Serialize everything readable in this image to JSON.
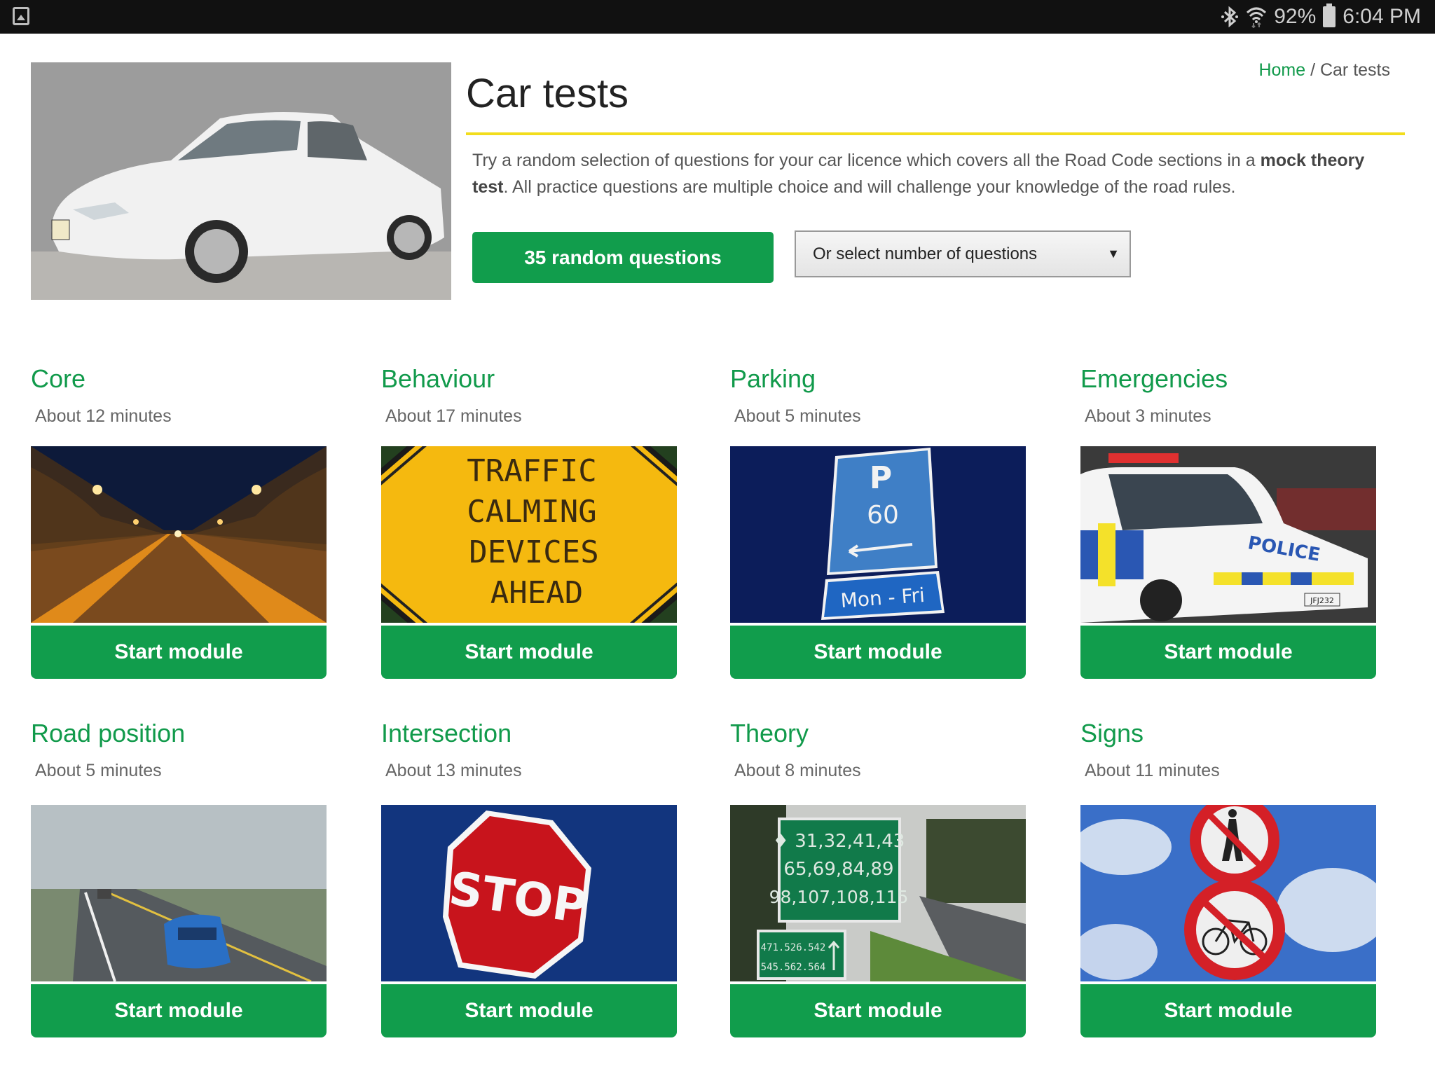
{
  "status_bar": {
    "left_icon": "gallery-icon",
    "bluetooth_icon": "bluetooth-icon",
    "wifi_icon": "wifi-icon",
    "battery_percent": "92%",
    "battery_icon": "battery-icon",
    "time": "6:04 PM"
  },
  "header": {
    "title": "Car tests",
    "breadcrumb": {
      "home": "Home",
      "separator": " / ",
      "current": "Car tests"
    },
    "hero_image": "white hatchback car",
    "intro_before": "Try a random selection of questions for your car licence which covers all the Road Code sections in a ",
    "intro_bold": "mock theory test",
    "intro_after": ". All practice questions are multiple choice and will challenge your knowledge of the road rules.",
    "random_button": "35 random questions",
    "select_placeholder": "Or select number of questions",
    "select_arrow": "▼"
  },
  "colors": {
    "accent_green": "#119d4c",
    "title_green": "#119a4b",
    "rule_yellow": "#f2dd1c"
  },
  "modules": [
    {
      "title": "Core",
      "duration": "About 12 minutes",
      "image": "night tunnel road",
      "button": "Start module"
    },
    {
      "title": "Behaviour",
      "duration": "About 17 minutes",
      "image": "traffic calming sign",
      "sign_lines": [
        "TRAFFIC",
        "CALMING",
        "DEVICES",
        "AHEAD"
      ],
      "button": "Start module"
    },
    {
      "title": "Parking",
      "duration": "About 5 minutes",
      "image": "parking sign",
      "sign_lines": [
        "P",
        "60",
        "Mon - Fri"
      ],
      "button": "Start module"
    },
    {
      "title": "Emergencies",
      "duration": "About 3 minutes",
      "image": "police car",
      "sign_lines": [
        "POLICE",
        "JFJ232"
      ],
      "button": "Start module"
    },
    {
      "title": "Road position",
      "duration": "About 5 minutes",
      "image": "blue car on foggy road",
      "button": "Start module"
    },
    {
      "title": "Intersection",
      "duration": "About 13 minutes",
      "image": "stop sign",
      "sign_lines": [
        "STOP"
      ],
      "button": "Start module"
    },
    {
      "title": "Theory",
      "duration": "About 8 minutes",
      "image": "green route sign",
      "sign_lines": [
        "♦ 31,32,41,43",
        "65,69,84,89",
        "98,107,108,115",
        "471.526.542",
        "545.562.564"
      ],
      "button": "Start module"
    },
    {
      "title": "Signs",
      "duration": "About 11 minutes",
      "image": "no pedestrians no cycling signs",
      "button": "Start module"
    }
  ]
}
